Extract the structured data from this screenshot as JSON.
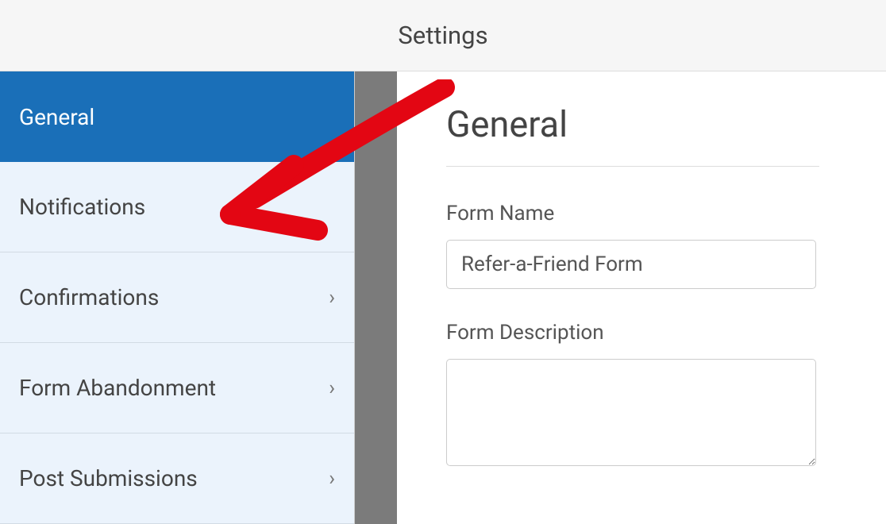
{
  "header": {
    "title": "Settings"
  },
  "sidebar": {
    "items": [
      {
        "label": "General",
        "has_chevron": false,
        "active": true
      },
      {
        "label": "Notifications",
        "has_chevron": false,
        "active": false
      },
      {
        "label": "Confirmations",
        "has_chevron": true,
        "active": false
      },
      {
        "label": "Form Abandonment",
        "has_chevron": true,
        "active": false
      },
      {
        "label": "Post Submissions",
        "has_chevron": true,
        "active": false
      }
    ]
  },
  "main": {
    "heading": "General",
    "form_name_label": "Form Name",
    "form_name_value": "Refer-a-Friend Form",
    "form_description_label": "Form Description",
    "form_description_value": ""
  },
  "annotation": {
    "type": "arrow",
    "color": "#e30613",
    "points_to": "Notifications"
  }
}
